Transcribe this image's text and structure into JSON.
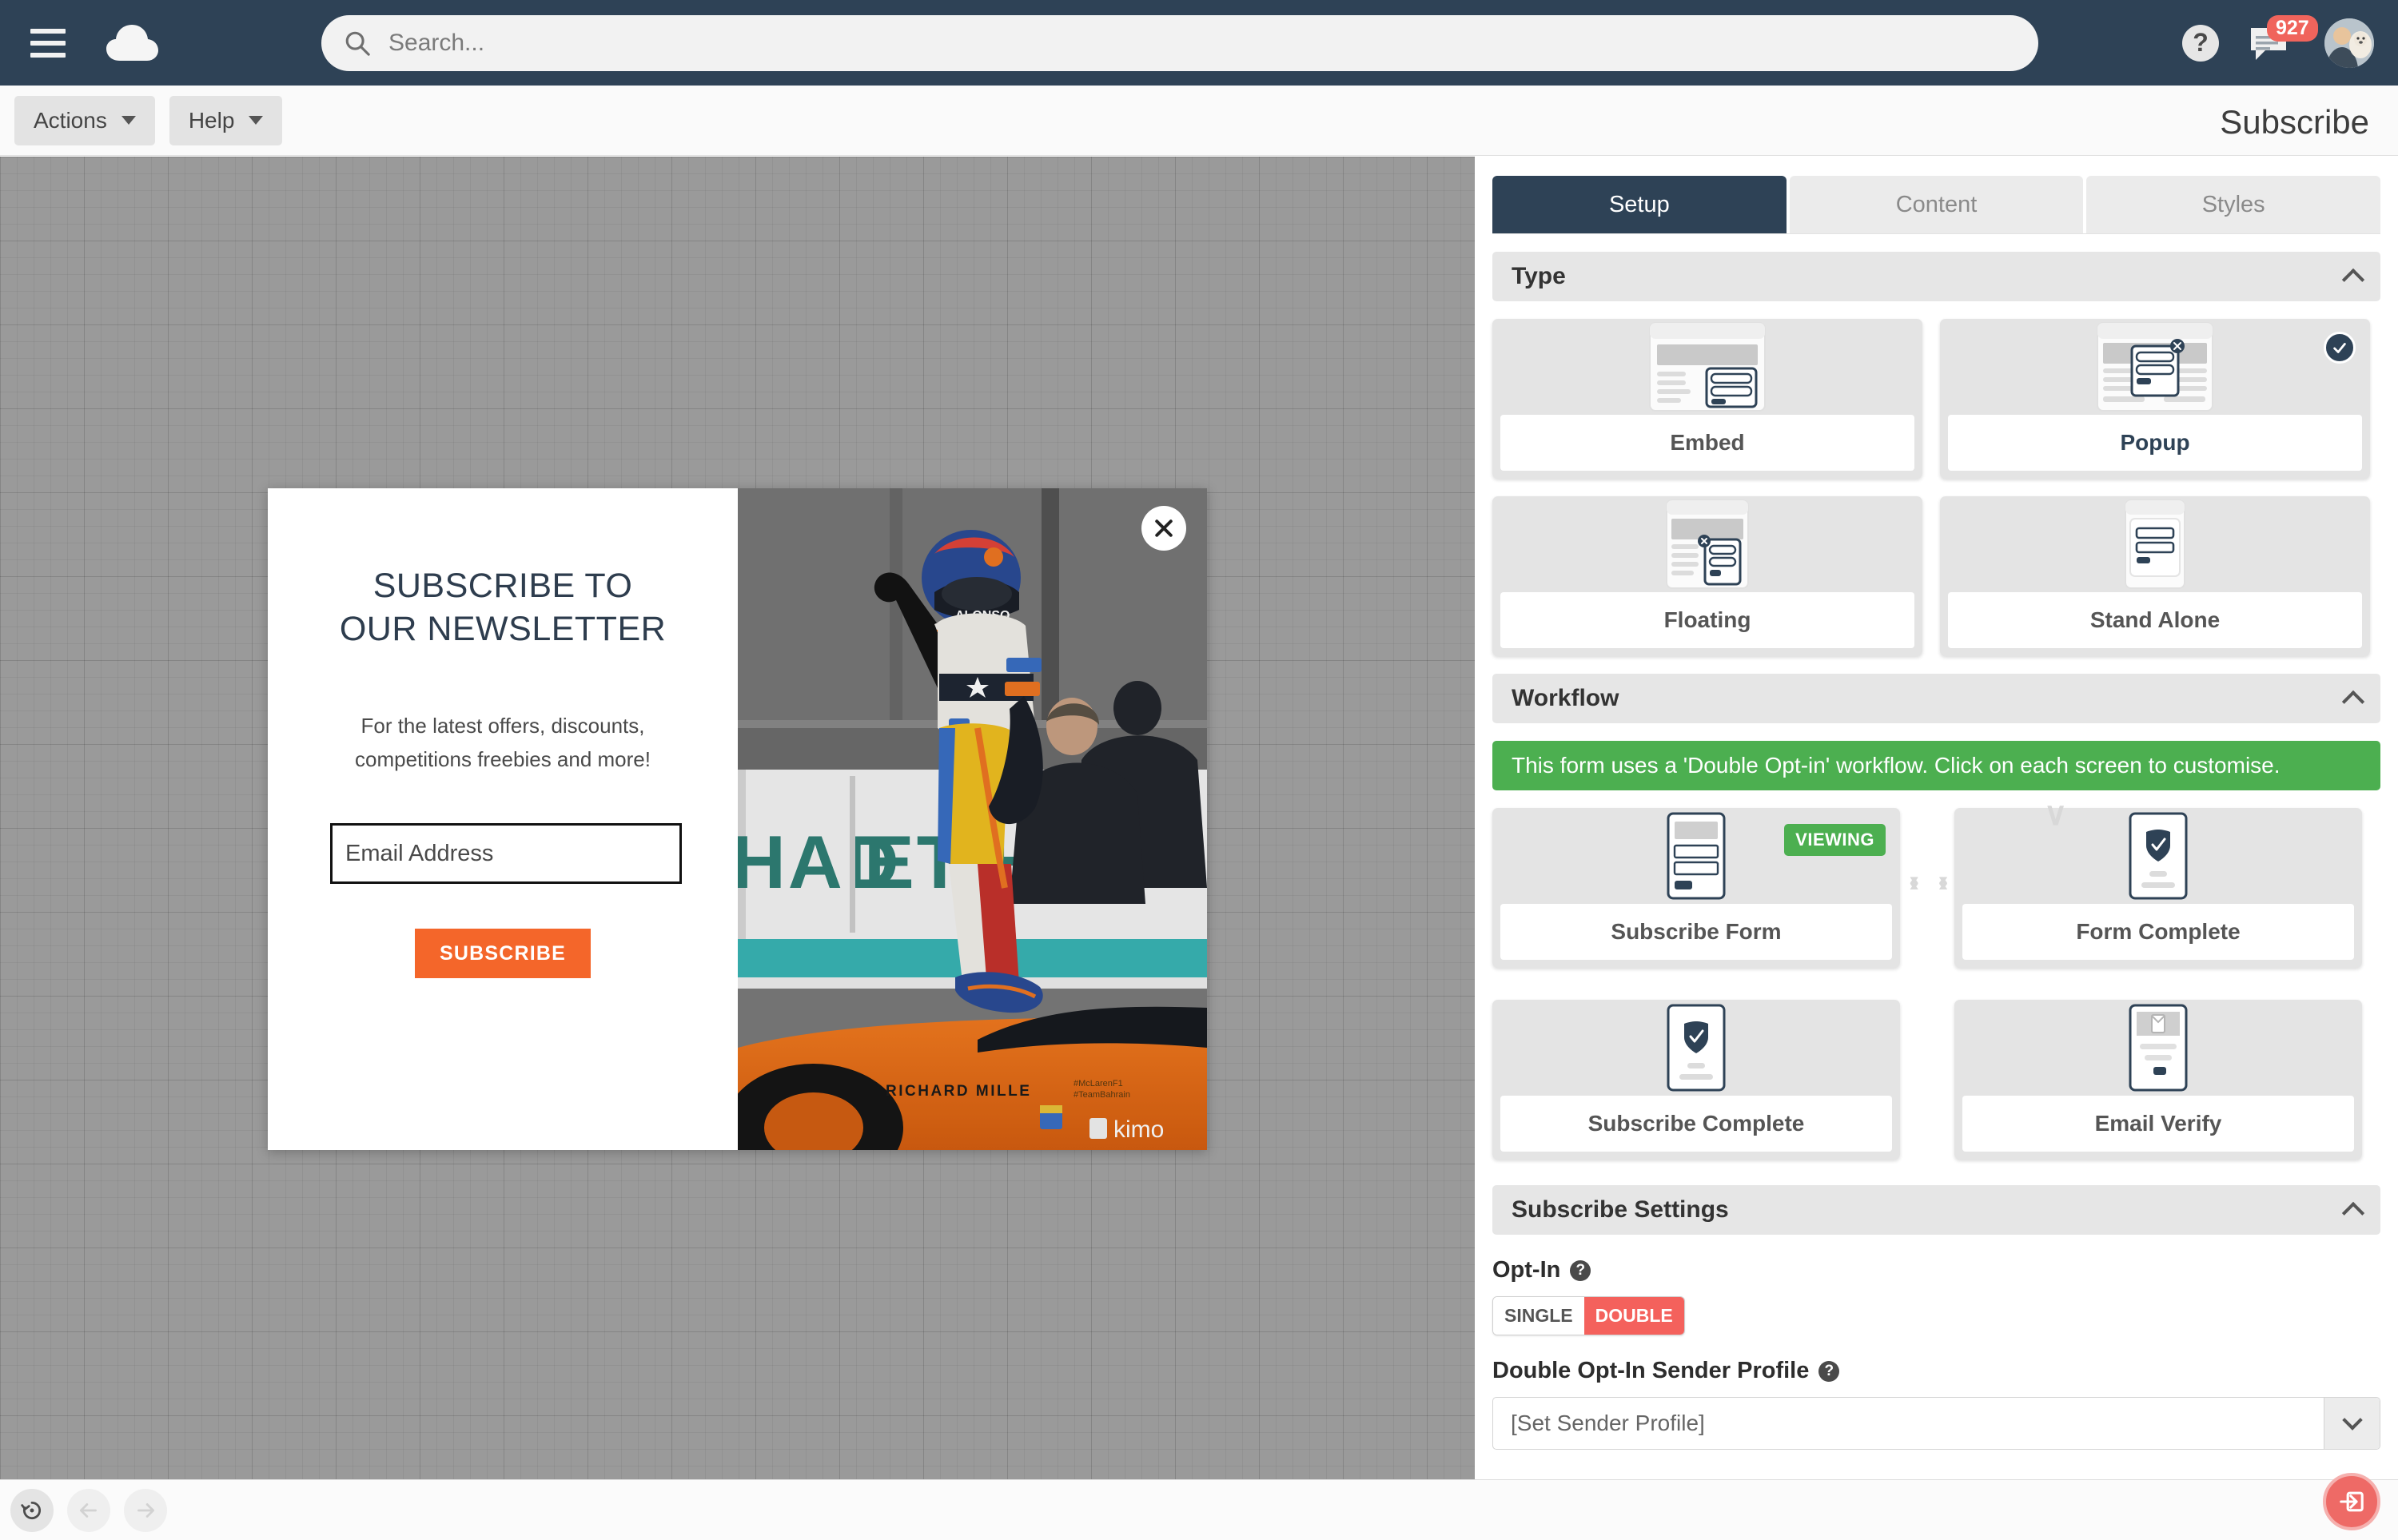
{
  "topnav": {
    "menu_icon": "hamburger-icon",
    "logo_icon": "cloud-logo-icon",
    "search_placeholder": "Search...",
    "search_value": "",
    "help_label": "?",
    "messages_badge": "927",
    "avatar_alt": "user-avatar"
  },
  "toolbar": {
    "actions_label": "Actions",
    "help_label": "Help",
    "page_title": "Subscribe"
  },
  "popup": {
    "heading": "SUBSCRIBE TO OUR NEWSLETTER",
    "subtext": "For the latest offers, discounts, competitions freebies and more!",
    "email_placeholder": "Email Address",
    "email_value": "",
    "button_label": "SUBSCRIBE",
    "close_icon": "close-icon",
    "image_alt": "f1-driver-photo",
    "accent_color": "#f4662a"
  },
  "panel": {
    "tabs": [
      {
        "label": "Setup",
        "active": true
      },
      {
        "label": "Content",
        "active": false
      },
      {
        "label": "Styles",
        "active": false
      }
    ],
    "type_section": {
      "title": "Type",
      "collapse_icon": "chevron-up-icon",
      "cards": [
        {
          "label": "Embed",
          "icon": "embed-layout-icon",
          "selected": false
        },
        {
          "label": "Popup",
          "icon": "popup-layout-icon",
          "selected": true
        },
        {
          "label": "Floating",
          "icon": "floating-layout-icon",
          "selected": false
        },
        {
          "label": "Stand Alone",
          "icon": "standalone-layout-icon",
          "selected": false
        }
      ]
    },
    "workflow_section": {
      "title": "Workflow",
      "collapse_icon": "chevron-up-icon",
      "banner": "This form uses a 'Double Opt-in' workflow. Click on each screen to customise.",
      "banner_color": "#4caf50",
      "cards": [
        {
          "label": "Subscribe Form",
          "icon": "form-screen-icon",
          "badge": "VIEWING"
        },
        {
          "label": "Form Complete",
          "icon": "check-screen-icon",
          "badge": ""
        },
        {
          "label": "Subscribe Complete",
          "icon": "shield-screen-icon",
          "badge": ""
        },
        {
          "label": "Email Verify",
          "icon": "envelope-screen-icon",
          "badge": ""
        }
      ],
      "connectors": {
        "right": "› ›",
        "down": "∨",
        "left": "‹ ‹"
      }
    },
    "settings_section": {
      "title": "Subscribe Settings",
      "collapse_icon": "chevron-up-icon",
      "optin_label": "Opt-In",
      "optin_options": [
        {
          "label": "SINGLE",
          "selected": false
        },
        {
          "label": "DOUBLE",
          "selected": true
        }
      ],
      "optin_active_color": "#f4615c",
      "sender_label": "Double Opt-In Sender Profile",
      "sender_value": "[Set Sender Profile]",
      "help_icon": "question-mark-icon"
    }
  },
  "footer": {
    "reset_icon": "reset-history-icon",
    "back_icon": "arrow-left-icon",
    "forward_icon": "arrow-right-icon",
    "fab_icon": "exit-arrow-icon",
    "fab_color": "#ee6a66"
  }
}
